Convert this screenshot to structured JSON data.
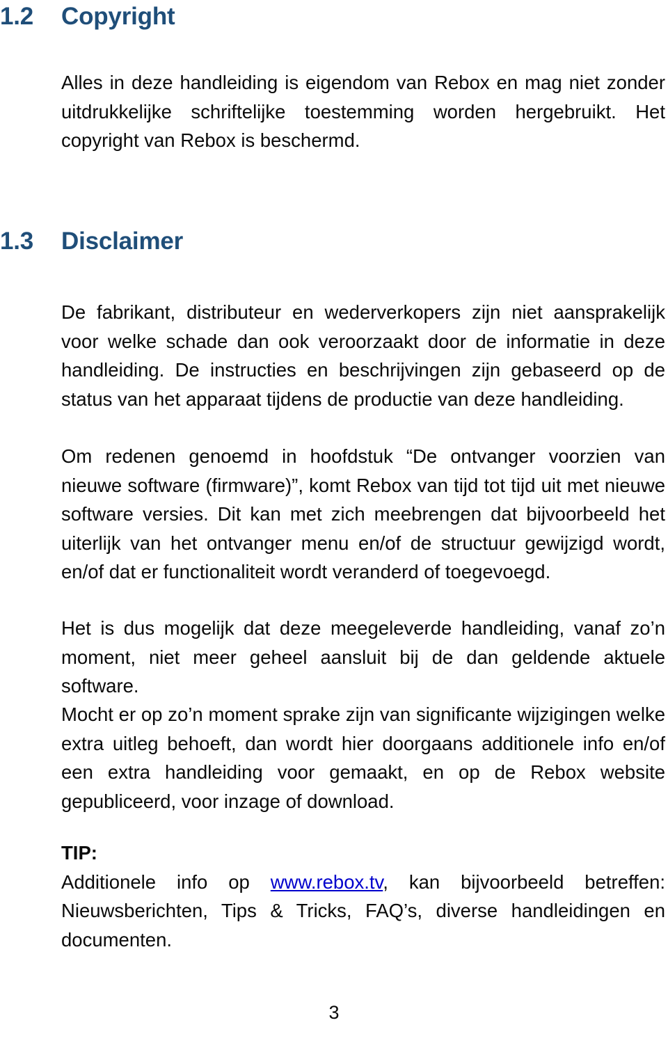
{
  "document": {
    "sections": [
      {
        "number": "1.2",
        "title": "Copyright",
        "paragraphs": [
          "Alles in deze handleiding is eigendom van Rebox en mag niet zonder uitdrukkelijke schriftelijke toestemming worden hergebruikt. Het copyright van Rebox is beschermd."
        ]
      },
      {
        "number": "1.3",
        "title": "Disclaimer",
        "paragraphs": [
          "De fabrikant, distributeur en wederverkopers zijn niet aansprakelijk voor welke schade dan ook veroorzaakt door de informatie in deze handleiding. De instructies en beschrijvingen zijn gebaseerd op de status van het apparaat tijdens de productie van deze handleiding.",
          "Om redenen genoemd in hoofdstuk “De ontvanger voorzien van nieuwe software (firmware)”, komt Rebox van tijd tot tijd uit met nieuwe software versies. Dit kan met zich meebrengen dat bijvoorbeeld het uiterlijk van het ontvanger menu en/of de structuur gewijzigd wordt, en/of dat er functionaliteit wordt veranderd of toegevoegd.",
          "Het is dus mogelijk dat deze meegeleverde handleiding, vanaf zo’n moment, niet meer geheel aansluit bij de dan geldende aktuele software.",
          "Mocht er op zo’n moment sprake zijn van significante wijzigingen welke extra uitleg behoeft, dan wordt hier doorgaans additionele info en/of een extra handleiding voor gemaakt, en op de Rebox website gepubliceerd, voor inzage of download."
        ]
      }
    ],
    "tip": {
      "label": "TIP:",
      "text_before_link": "Additionele info op ",
      "link_text": "www.rebox.tv",
      "text_after_link": ", kan bijvoorbeeld betreffen: Nieuwsberichten, Tips & Tricks, FAQ’s, diverse handleidingen en documenten."
    },
    "footer": {
      "page_number": "3"
    },
    "colors": {
      "heading": "#1F4E79",
      "body": "#0a0a0a",
      "link": "#0000CC",
      "background": "#ffffff"
    }
  }
}
